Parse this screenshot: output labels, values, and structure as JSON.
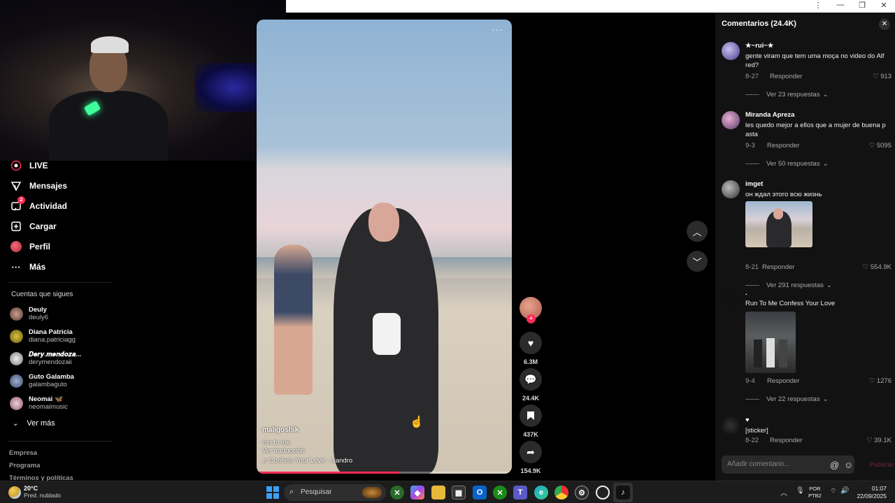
{
  "browser": {
    "menu_icon": "kebab-menu-icon",
    "minimize": "—",
    "restore": "❐",
    "close": "✕"
  },
  "sidebar": {
    "nav": [
      {
        "label": "LIVE",
        "icon": "live-icon"
      },
      {
        "label": "Mensajes",
        "icon": "send-icon"
      },
      {
        "label": "Actividad",
        "icon": "activity-icon",
        "badge": "2"
      },
      {
        "label": "Cargar",
        "icon": "upload-icon"
      },
      {
        "label": "Perfil",
        "icon": "profile-icon"
      },
      {
        "label": "Más",
        "icon": "more-icon"
      }
    ],
    "following_title": "Cuentas que sigues",
    "following": [
      {
        "name": "Deuly",
        "handle": "deuly6"
      },
      {
        "name": "Diana Patricia",
        "handle": "diana.patriciagg"
      },
      {
        "name": "𝑫𝒆𝒓𝒚.𝒎𝒆𝒏𝒅𝒐𝒛𝒂...",
        "handle": "derymendozaii"
      },
      {
        "name": "Guto Galamba",
        "handle": "galambaguto"
      },
      {
        "name": "Neomai 🦋",
        "handle": "neomaimusic"
      }
    ],
    "see_more": "Ver más",
    "footer": [
      "Empresa",
      "Programa",
      "Términos y políticas"
    ]
  },
  "video": {
    "author": "maligoshik",
    "description": "run to me",
    "translate": "Ver traducción",
    "music": "♫ Confess Your Love - Jiandro",
    "progress": 0.56
  },
  "actions": {
    "likes": "6.3M",
    "comments": "24.4K",
    "saves": "437K",
    "shares": "154.9K"
  },
  "comments": {
    "title": "Comentarios (24.4K)",
    "reply_label": "Responder",
    "items": [
      {
        "user": "★~rui~★",
        "text": "gente viram que tem uma moça no video do Alf red?",
        "date": "8-27",
        "likes": "913",
        "view": "Ver 23 respuestas"
      },
      {
        "user": "Miranda Apreza",
        "text": "les quedo mejor a ellos que a mujer de buena p asta",
        "date": "9-3",
        "likes": "5095",
        "view": "Ver 50 respuestas"
      },
      {
        "user": "imget",
        "text": "он ждал этого всю жизнь",
        "date": "8-21",
        "likes": "554.9K",
        "view": "Ver 291 respuestas"
      },
      {
        "user": ".",
        "text": "Run To Me Confess Your Love",
        "date": "9-4",
        "likes": "1276",
        "view": "Ver 22 respuestas"
      },
      {
        "user": "♥",
        "text": "[sticker]",
        "date": "8-22",
        "likes": "39.1K",
        "view": ""
      }
    ],
    "input_placeholder": "Añadir comentario...",
    "post_label": "Publicar"
  },
  "taskbar": {
    "temp": "20°C",
    "weather": "Pred. nublado",
    "search_placeholder": "Pesquisar",
    "lang_top": "POR",
    "lang_bottom": "PTB2",
    "time": "01:07",
    "date": "22/09/2025"
  },
  "colors": {
    "accent": "#fe2c55",
    "panel": "#121212",
    "background": "#000000"
  }
}
